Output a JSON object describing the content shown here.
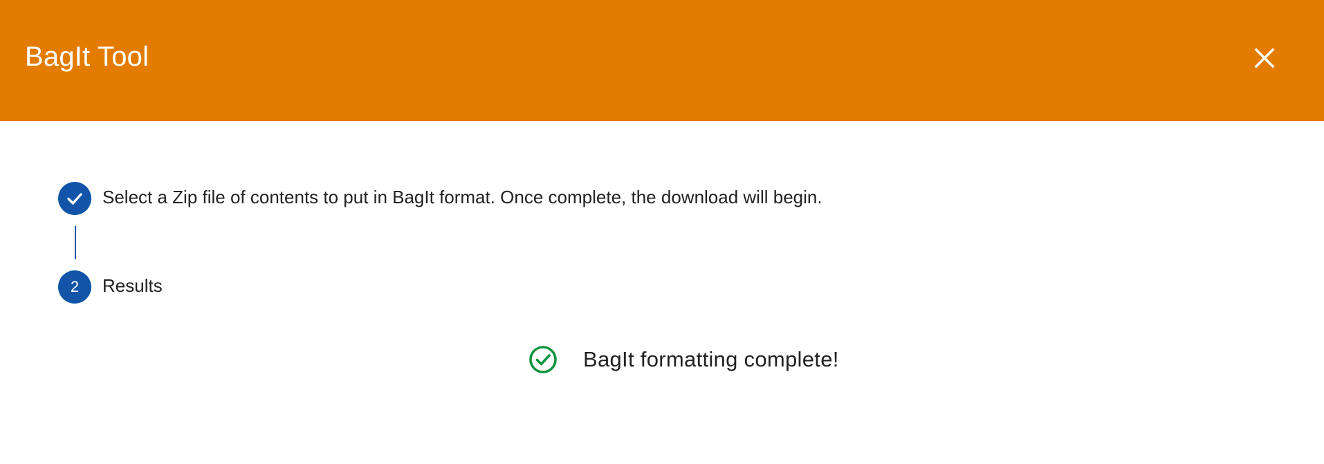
{
  "dialog": {
    "title": "BagIt Tool",
    "close_icon": "close-icon",
    "header_color": "#e37b00"
  },
  "stepper": {
    "accent_color": "#1255a8",
    "steps": [
      {
        "status": "completed",
        "icon": "check-icon",
        "label": "Select a Zip file of contents to put in BagIt format. Once complete, the download will begin."
      },
      {
        "status": "active",
        "number": "2",
        "label": "Results"
      }
    ]
  },
  "result": {
    "icon": "check-circle-icon",
    "icon_color": "#0e9440",
    "message": "BagIt formatting complete!"
  }
}
